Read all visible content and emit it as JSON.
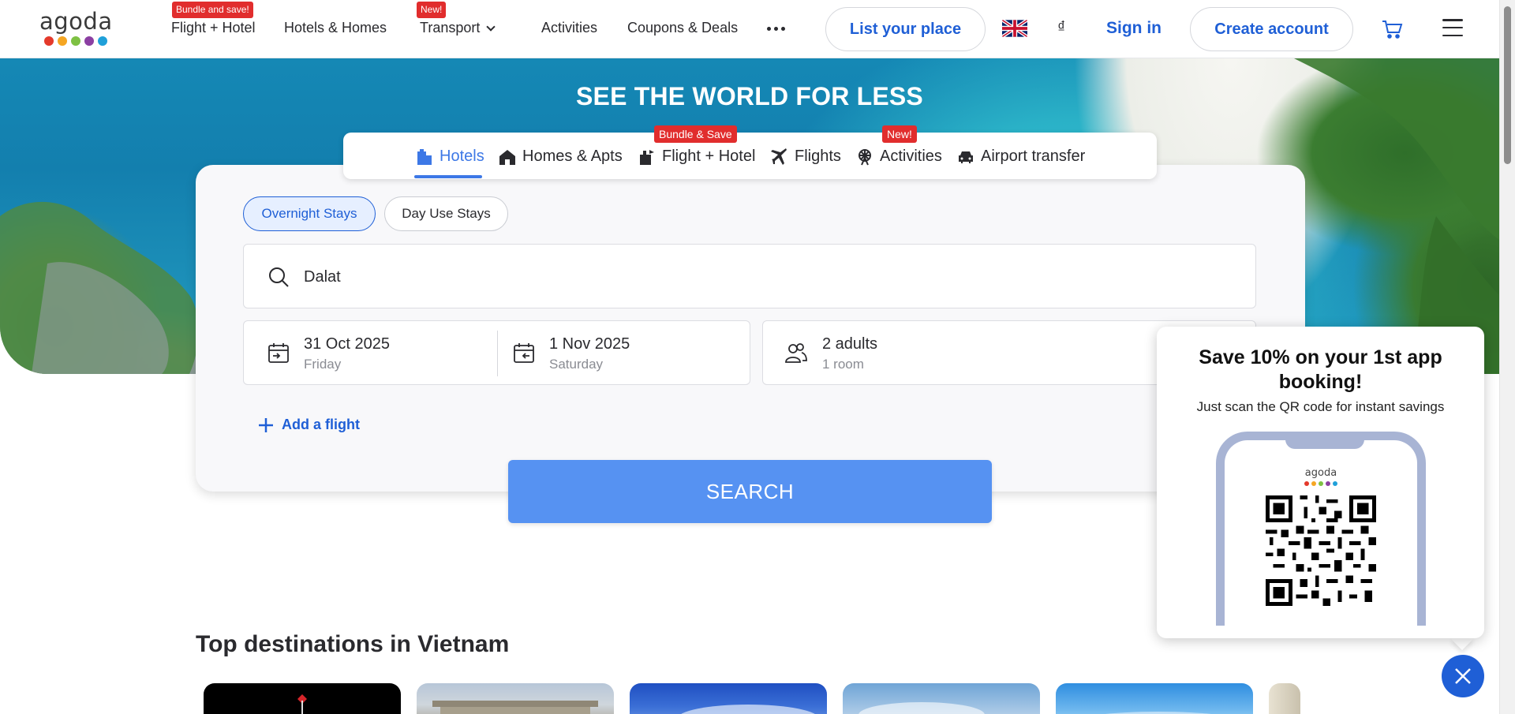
{
  "brand": {
    "logo_text": "agoda",
    "logo_dot_colors": [
      "#e4392b",
      "#f5a623",
      "#7ec143",
      "#8b3fa2",
      "#1fa0d9"
    ]
  },
  "header": {
    "nav": [
      {
        "label": "Flight + Hotel",
        "badge": "Bundle and save!"
      },
      {
        "label": "Hotels & Homes"
      },
      {
        "label": "Transport",
        "badge": "New!"
      },
      {
        "label": "Activities"
      },
      {
        "label": "Coupons & Deals"
      }
    ],
    "list_place_label": "List your place",
    "currency_symbol": "₫",
    "sign_in_label": "Sign in",
    "create_account_label": "Create account"
  },
  "hero": {
    "title": "SEE THE WORLD FOR LESS"
  },
  "search": {
    "tabs": [
      {
        "label": "Hotels",
        "icon": "hotel-icon"
      },
      {
        "label": "Homes & Apts",
        "icon": "home-icon"
      },
      {
        "label": "Flight + Hotel",
        "icon": "flight-hotel-icon",
        "badge": "Bundle & Save"
      },
      {
        "label": "Flights",
        "icon": "airplane-icon"
      },
      {
        "label": "Activities",
        "icon": "ferris-wheel-icon",
        "badge": "New!"
      },
      {
        "label": "Airport transfer",
        "icon": "car-icon"
      }
    ],
    "stay_types": [
      "Overnight Stays",
      "Day Use Stays"
    ],
    "destination": "Dalat",
    "check_in": {
      "date": "31 Oct 2025",
      "day": "Friday"
    },
    "check_out": {
      "date": "1 Nov 2025",
      "day": "Saturday"
    },
    "guests": {
      "adults": "2 adults",
      "rooms": "1 room"
    },
    "add_flight_label": "Add a flight",
    "search_label": "SEARCH"
  },
  "destinations": {
    "title": "Top destinations in Vietnam"
  },
  "promo": {
    "title": "Save 10% on your 1st app booking!",
    "subtitle": "Just scan the QR code for instant savings",
    "phone_logo": "agoda"
  },
  "colors": {
    "accent": "#1f5fd6",
    "tab_active": "#3d78e6",
    "search_button": "#5692f2",
    "badge": "#e12d2d"
  }
}
